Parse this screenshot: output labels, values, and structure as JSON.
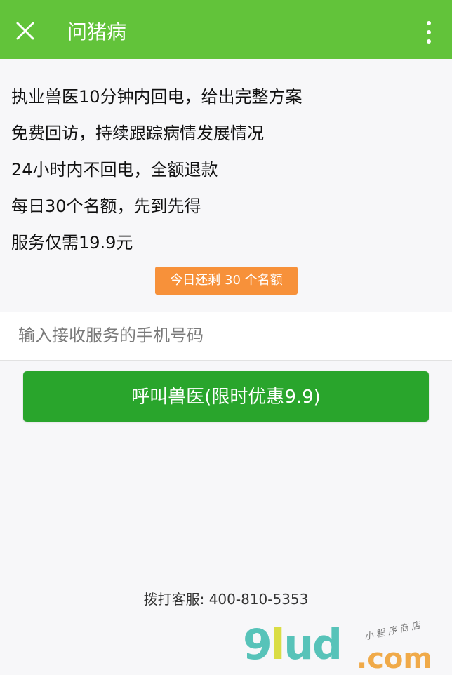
{
  "navbar": {
    "title": "问猪病",
    "bg_color": "#62c33a",
    "close_icon": "close-icon",
    "more_icon": "more-vertical-icon"
  },
  "features": [
    "执业兽医10分钟内回电，给出完整方案",
    "免费回访，持续跟踪病情发展情况",
    "24小时内不回电，全额退款",
    "每日30个名额，先到先得",
    "服务仅需19.9元"
  ],
  "quota": {
    "label": "今日还剩 30 个名额",
    "color": "#f7913a"
  },
  "phone_input": {
    "placeholder": "输入接收服务的手机号码",
    "value": ""
  },
  "call_button": {
    "label": "呼叫兽医(限时优惠9.9)",
    "color": "#29a52c"
  },
  "hotline": {
    "label": "拨打客服:",
    "number": "400-810-5353"
  },
  "watermark": {
    "logo_a": "9lud",
    "logo_b": ".com",
    "tagline": "小程序商店"
  }
}
